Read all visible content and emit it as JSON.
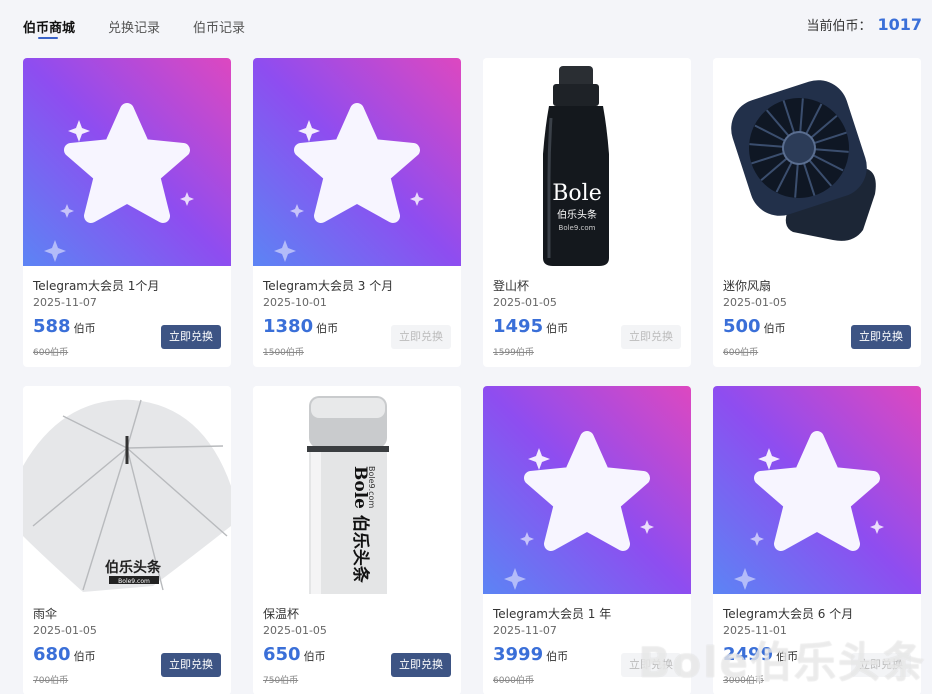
{
  "tabs": [
    {
      "label": "伯币商城",
      "active": true
    },
    {
      "label": "兑换记录",
      "active": false
    },
    {
      "label": "伯币记录",
      "active": false
    }
  ],
  "balance": {
    "label": "当前伯币：",
    "value": "1017"
  },
  "unit": "伯币",
  "products": [
    {
      "title": "Telegram大会员 1个月",
      "date": "2025-11-07",
      "price": "588",
      "original": "600伯币",
      "button": "立即兑换",
      "button_enabled": true,
      "image": "telegram-star"
    },
    {
      "title": "Telegram大会员 3 个月",
      "date": "2025-10-01",
      "price": "1380",
      "original": "1500伯币",
      "button": "立即兑换",
      "button_enabled": false,
      "image": "telegram-star"
    },
    {
      "title": "登山杯",
      "date": "2025-01-05",
      "price": "1495",
      "original": "1599伯币",
      "button": "立即兑换",
      "button_enabled": false,
      "image": "black-bottle",
      "image_text": [
        "Bole",
        "伯乐头条",
        "Bole9.com"
      ]
    },
    {
      "title": "迷你风扇",
      "date": "2025-01-05",
      "price": "500",
      "original": "600伯币",
      "button": "立即兑换",
      "button_enabled": true,
      "image": "mini-fan"
    },
    {
      "title": "雨伞",
      "date": "2025-01-05",
      "price": "680",
      "original": "700伯币",
      "button": "立即兑换",
      "button_enabled": true,
      "image": "white-umbrella",
      "image_text": [
        "伯乐头条",
        "Bole9.com"
      ]
    },
    {
      "title": "保温杯",
      "date": "2025-01-05",
      "price": "650",
      "original": "750伯币",
      "button": "立即兑换",
      "button_enabled": true,
      "image": "thermos-cup",
      "image_text": [
        "Bole 伯乐头条",
        "Bole9.com"
      ]
    },
    {
      "title": "Telegram大会员 1 年",
      "date": "2025-11-07",
      "price": "3999",
      "original": "6000伯币",
      "button": "立即兑换",
      "button_enabled": false,
      "image": "telegram-star"
    },
    {
      "title": "Telegram大会员 6 个月",
      "date": "2025-11-01",
      "price": "2499",
      "original": "3000伯币",
      "button": "立即兑换",
      "button_enabled": false,
      "image": "telegram-star"
    }
  ],
  "watermark": "Bole伯乐头条"
}
